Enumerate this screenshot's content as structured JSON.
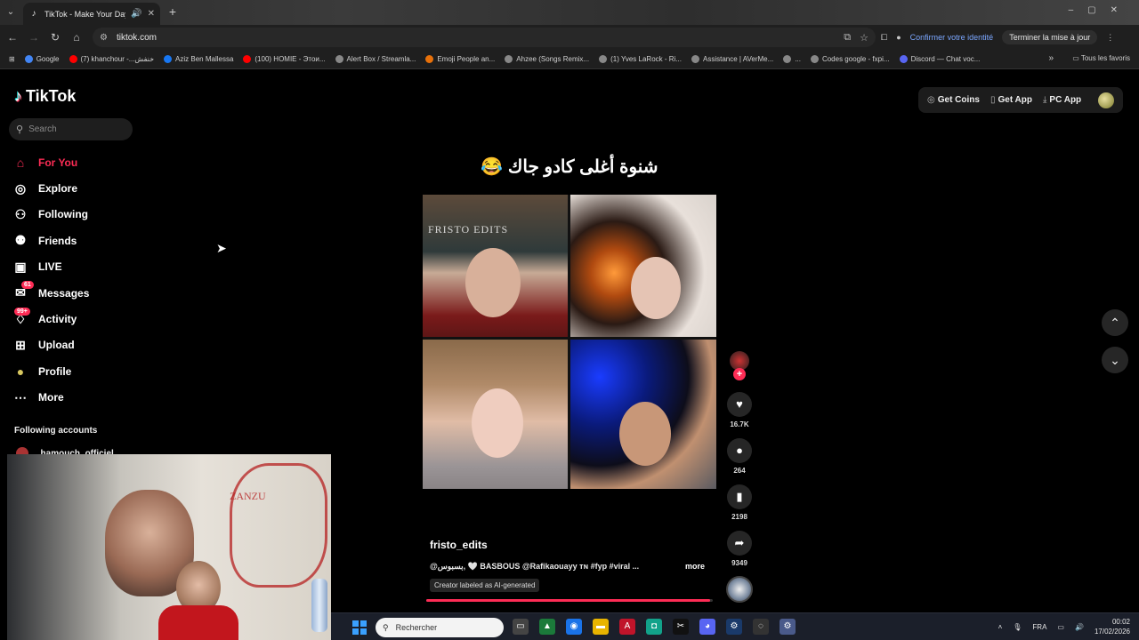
{
  "browser": {
    "tab_title": "TikTok - Make Your Day",
    "url": "tiktok.com",
    "identity_prompt": "Confirmer votre identité",
    "update_button": "Terminer la mise à jour",
    "all_bookmarks": "Tous les favoris",
    "bookmarks": [
      {
        "label": "Google",
        "color": "#4285f4"
      },
      {
        "label": "(7) khanchour -...خنفش",
        "color": "#ff0000"
      },
      {
        "label": "Aziz Ben Mallessa",
        "color": "#1877f2"
      },
      {
        "label": "(100) HOMIE - Этои...",
        "color": "#ff0000"
      },
      {
        "label": "Alert Box / Streamla...",
        "color": "#888888"
      },
      {
        "label": "Emoji People an...",
        "color": "#e8710a"
      },
      {
        "label": "Ahzee (Songs Remix...",
        "color": "#888888"
      },
      {
        "label": "(1) Yves LaRock - Ri...",
        "color": "#888888"
      },
      {
        "label": "Assistance | AVerMe...",
        "color": "#888888"
      },
      {
        "label": "...",
        "color": "#888888"
      },
      {
        "label": "Codes google - fxpi...",
        "color": "#888888"
      },
      {
        "label": "Discord — Chat voc...",
        "color": "#5865f2"
      }
    ]
  },
  "tiktok": {
    "logo": "TikTok",
    "search_placeholder": "Search",
    "nav": [
      {
        "label": "For You",
        "icon": "home-icon",
        "glyph": "⌂",
        "badge": ""
      },
      {
        "label": "Explore",
        "icon": "compass-icon",
        "glyph": "◎",
        "badge": ""
      },
      {
        "label": "Following",
        "icon": "following-icon",
        "glyph": "⚇",
        "badge": ""
      },
      {
        "label": "Friends",
        "icon": "friends-icon",
        "glyph": "⚉",
        "badge": ""
      },
      {
        "label": "LIVE",
        "icon": "live-icon",
        "glyph": "▣",
        "badge": ""
      },
      {
        "label": "Messages",
        "icon": "messages-icon",
        "glyph": "✉",
        "badge": "61"
      },
      {
        "label": "Activity",
        "icon": "activity-icon",
        "glyph": "♢",
        "badge": "99+"
      },
      {
        "label": "Upload",
        "icon": "upload-icon",
        "glyph": "⊞",
        "badge": ""
      },
      {
        "label": "Profile",
        "icon": "profile-avatar-icon",
        "glyph": "●",
        "badge": ""
      },
      {
        "label": "More",
        "icon": "more-icon",
        "glyph": "⋯",
        "badge": ""
      }
    ],
    "following_accounts_heading": "Following accounts",
    "following_account": "_hamouch_officiel",
    "header_buttons": {
      "coins": "Get Coins",
      "app": "Get App",
      "pc": "PC App"
    },
    "video": {
      "caption_title": "شنوة أغلى كادو جاك 😂",
      "watermark": "FRISTO EDITS",
      "username": "fristo_edits",
      "description": "@بسبوس, 🤍 BASBOUS @Rafikaouayy ᴛɴ #fyp #viral ...",
      "more": "more",
      "ai_label": "Creator labeled as AI-generated",
      "likes": "16.7K",
      "comments": "264",
      "saves": "2198",
      "shares": "9349",
      "progress": 0.99
    }
  },
  "taskbar": {
    "search_placeholder": "Rechercher",
    "language": "FRA",
    "time": "00:02",
    "date": "17/02/2026"
  },
  "colors": {
    "accent": "#fe2c55",
    "bg": "#000000",
    "windows_blue": "#3aa0ff"
  }
}
